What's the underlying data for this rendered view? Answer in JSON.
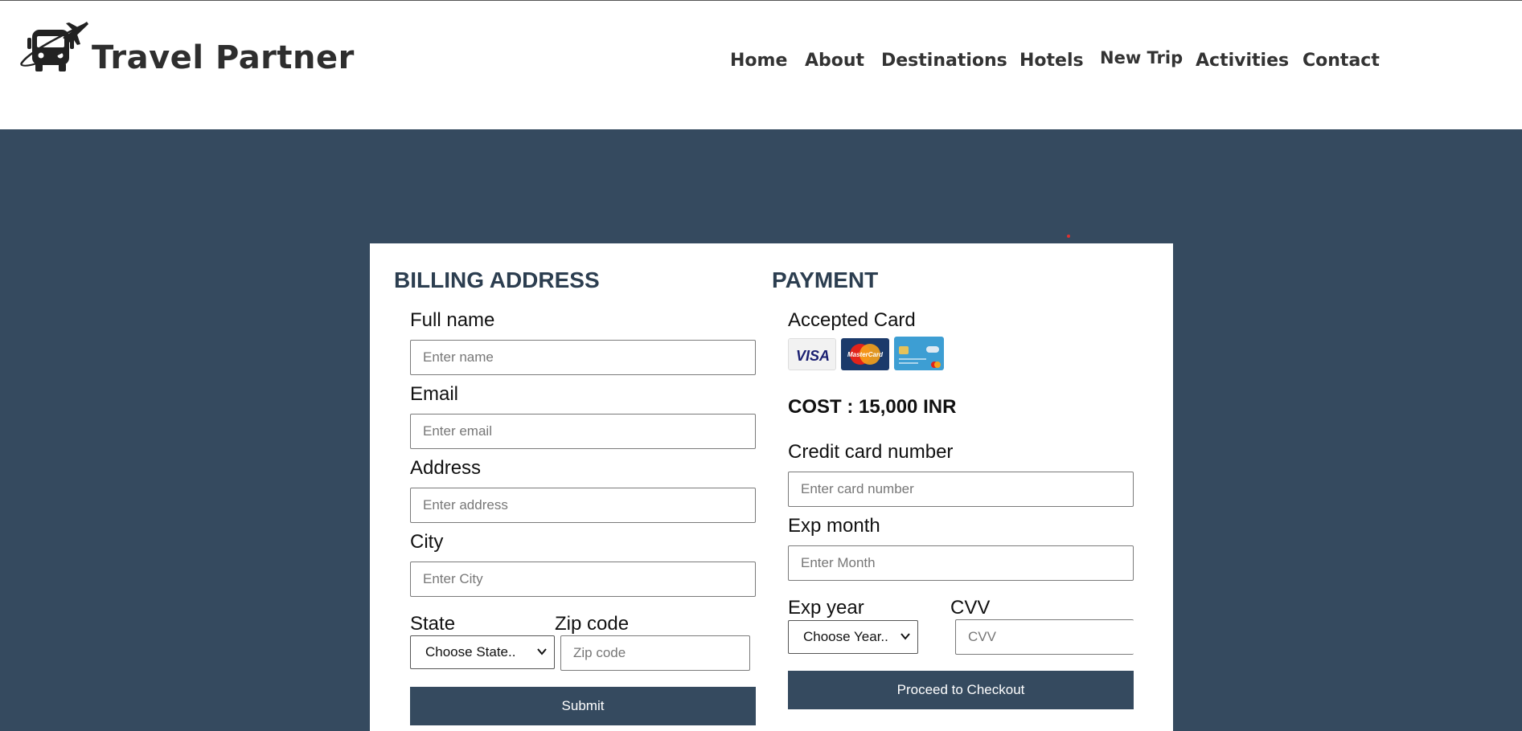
{
  "header": {
    "brand": "Travel Partner",
    "logo_icon": "bus-airplane-logo-icon",
    "nav": [
      "Home",
      "About",
      "Destinations",
      "Hotels",
      "New Trip",
      "Activities",
      "Contact"
    ]
  },
  "billing": {
    "title": "BILLING ADDRESS",
    "full_name_label": "Full name",
    "full_name_placeholder": "Enter name",
    "email_label": "Email",
    "email_placeholder": "Enter email",
    "address_label": "Address",
    "address_placeholder": "Enter address",
    "city_label": "City",
    "city_placeholder": "Enter City",
    "state_label": "State",
    "state_selected": "Choose State..",
    "zip_label": "Zip code",
    "zip_placeholder": "Zip code",
    "submit_label": "Submit"
  },
  "payment": {
    "title": "PAYMENT",
    "accepted_label": "Accepted Card",
    "card_icons": [
      "visa-card-icon",
      "mastercard-card-icon",
      "credit-card-icon"
    ],
    "visa_text": "VISA",
    "mastercard_text": "MasterCard",
    "cost": "COST : 15,000 INR",
    "card_number_label": "Credit card number",
    "card_number_placeholder": "Enter card number",
    "exp_month_label": "Exp month",
    "exp_month_placeholder": "Enter Month",
    "exp_year_label": "Exp year",
    "exp_year_selected": "Choose Year..",
    "cvv_label": "CVV",
    "cvv_placeholder": "CVV",
    "checkout_label": "Proceed to Checkout"
  },
  "colors": {
    "band": "#354a5f",
    "button": "#354a5f",
    "section_title": "#2c3e50"
  }
}
